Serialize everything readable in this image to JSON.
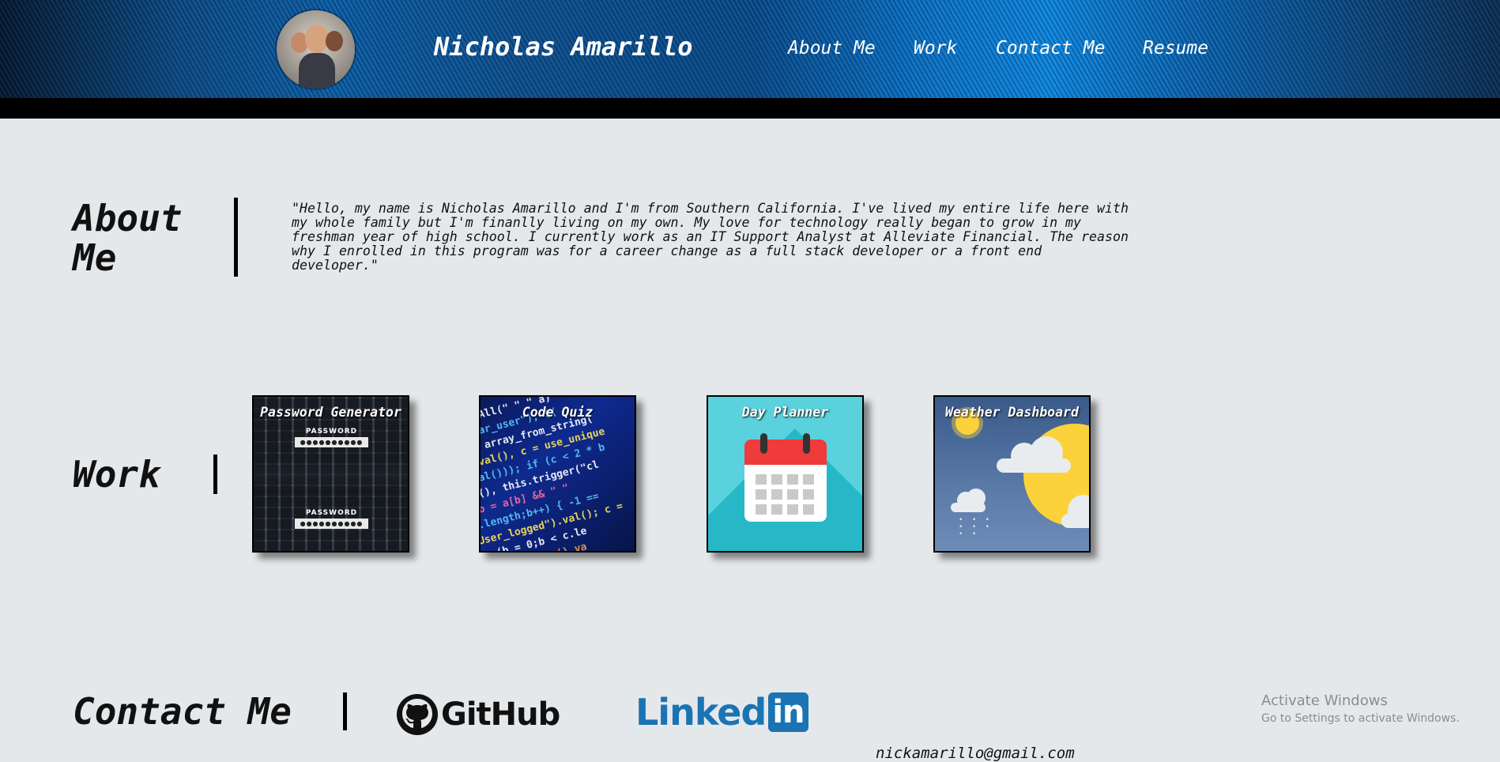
{
  "header": {
    "site_title": "Nicholas Amarillo",
    "nav": [
      {
        "label": "About Me"
      },
      {
        "label": "Work"
      },
      {
        "label": "Contact Me"
      },
      {
        "label": "Resume"
      }
    ]
  },
  "about": {
    "title": "About Me",
    "text": "\"Hello, my name is Nicholas Amarillo and I'm from Southern California. I've lived my entire life here with my whole family but I'm finanlly living on my own. My love for technology really began to grow in my freshman year of high school. I currently work as an IT Support Analyst at Alleviate Financial. The reason why I enrolled in this program was for a career change as a full stack developer or a front end developer.\""
  },
  "work": {
    "title": "Work",
    "projects": [
      {
        "label": "Password Generator",
        "thumb_text": "PASSWORD",
        "thumb_field": "●●●●●●●●●●"
      },
      {
        "label": "Code Quiz"
      },
      {
        "label": "Day Planner"
      },
      {
        "label": "Weather Dashboard"
      }
    ]
  },
  "contact": {
    "title": "Contact Me",
    "github_label": "GitHub",
    "linkedin_label": "Linked",
    "linkedin_in": "in",
    "email": "nickamarillo@gmail.com"
  },
  "watermark": {
    "title": "Activate Windows",
    "subtitle": "Go to Settings to activate Windows."
  },
  "colors": {
    "header_blue": "#0a5ea8",
    "page_bg": "#e5e8ea",
    "linkedin_blue": "#1a74b4",
    "calendar_red": "#ef3b3b",
    "day_planner_bg": "#5ad2dd"
  }
}
